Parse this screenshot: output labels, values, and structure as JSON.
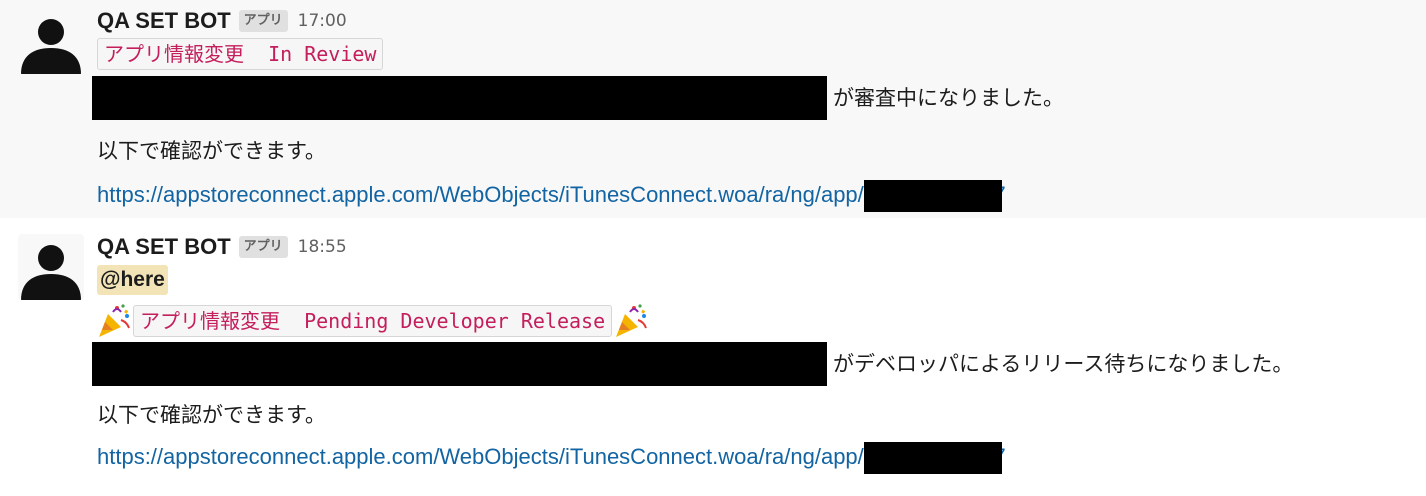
{
  "messages": [
    {
      "sender": "QA SET BOT",
      "badge": "アプリ",
      "time": "17:00",
      "code_label": "アプリ情報変更  In Review",
      "status_text": "が審査中になりました。",
      "confirm_text": "以下で確認ができます。",
      "link_text": "https://appstoreconnect.apple.com/WebObjects/iTunesConnect.woa/ra/ng/app/",
      "link_tail": "7"
    },
    {
      "sender": "QA SET BOT",
      "badge": "アプリ",
      "time": "18:55",
      "mention": "@here",
      "code_label": "アプリ情報変更  Pending Developer Release",
      "status_text": "がデベロッパによるリリース待ちになりました。",
      "confirm_text": "以下で確認ができます。",
      "link_text": "https://appstoreconnect.apple.com/WebObjects/iTunesConnect.woa/ra/ng/app/",
      "link_tail": "7"
    }
  ],
  "icons": {
    "avatar": "user-silhouette-icon",
    "celebration": "party-popper-icon"
  },
  "colors": {
    "highlight_bg": "#f8f8f8",
    "link": "#1264a3",
    "code_text": "#c41e5c",
    "mention_bg": "#f2e4b7"
  }
}
